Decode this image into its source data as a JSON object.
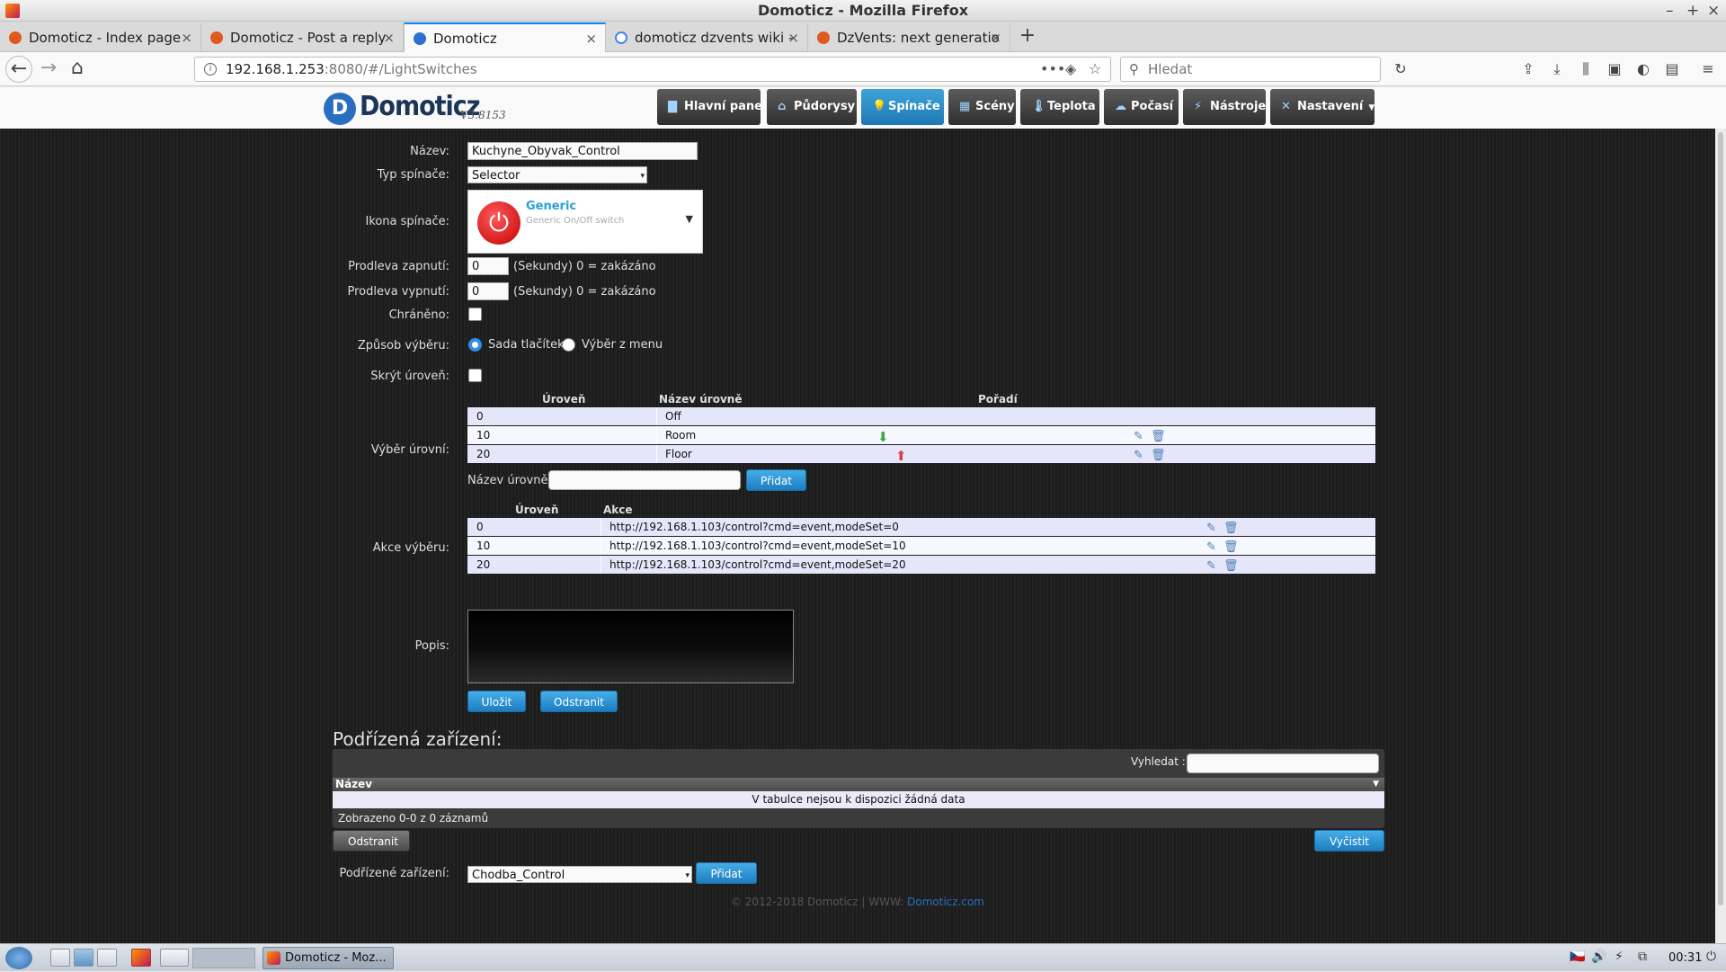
{
  "window": {
    "title": "Domoticz - Mozilla Firefox"
  },
  "tabs": [
    {
      "label": "Domoticz - Index page"
    },
    {
      "label": "Domoticz - Post a reply"
    },
    {
      "label": "Domoticz"
    },
    {
      "label": "domoticz dzvents wiki -"
    },
    {
      "label": "DzVents: next generatio"
    }
  ],
  "nav": {
    "url_host": "192.168.1.253",
    "url_rest": ":8080/#/LightSwitches",
    "search_placeholder": "Hledat"
  },
  "app": {
    "logo_name": "Domoticz",
    "version": "V3.8153",
    "menu": [
      {
        "label": "Hlavní panel"
      },
      {
        "label": "Půdorysy"
      },
      {
        "label": "Spínače"
      },
      {
        "label": "Scény"
      },
      {
        "label": "Teplota"
      },
      {
        "label": "Počasí"
      },
      {
        "label": "Nástroje"
      },
      {
        "label": "Nastavení"
      }
    ],
    "active_menu": "Spínače",
    "accent_color": "#2f8ee0"
  },
  "form": {
    "name_label": "Název:",
    "name_value": "Kuchyne_Obyvak_Control",
    "type_label": "Typ spínače:",
    "type_value": "Selector",
    "icon_label": "Ikona spínače:",
    "icon_title": "Generic",
    "icon_subtitle": "Generic On/Off switch",
    "on_delay_label": "Prodleva zapnutí:",
    "on_delay_value": "0",
    "off_delay_label": "Prodleva vypnutí:",
    "off_delay_value": "0",
    "delay_hint": "(Sekundy) 0 = zakázáno",
    "protected_label": "Chráněno:",
    "select_mode_label": "Způsob výběru:",
    "select_mode_buttons": "Sada tlačítek",
    "select_mode_menu": "Výběr z menu",
    "hide_level_label": "Skrýt úroveň:",
    "levels_label": "Výběr úrovní:",
    "levels_headers": {
      "level": "Úroveň",
      "name": "Název úrovně",
      "order": "Pořadí"
    },
    "levels": [
      {
        "level": "0",
        "name": "Off"
      },
      {
        "level": "10",
        "name": "Room"
      },
      {
        "level": "20",
        "name": "Floor"
      }
    ],
    "level_name_label": "Název úrovně:",
    "add_button": "Přidat",
    "actions_label": "Akce výběru:",
    "actions_headers": {
      "level": "Úroveň",
      "action": "Akce"
    },
    "actions": [
      {
        "level": "0",
        "action": "http://192.168.1.103/control?cmd=event,modeSet=0"
      },
      {
        "level": "10",
        "action": "http://192.168.1.103/control?cmd=event,modeSet=10"
      },
      {
        "level": "20",
        "action": "http://192.168.1.103/control?cmd=event,modeSet=20"
      }
    ],
    "description_label": "Popis:",
    "save_button": "Uložit",
    "delete_button": "Odstranit"
  },
  "subdevices": {
    "title": "Podřízená zařízení:",
    "search_label": "Vyhledat :",
    "col_name": "Název",
    "empty_text": "V tabulce nejsou k dispozici žádná data",
    "info_text": "Zobrazeno 0-0 z 0 záznamů",
    "delete_button": "Odstranit",
    "clear_button": "Vyčistit",
    "select_label": "Podřízené zařízení:",
    "select_value": "Chodba_Control",
    "add_button": "Přidat"
  },
  "footer": {
    "text": "© 2012-2018 Domoticz | WWW: ",
    "link": "Domoticz.com"
  },
  "taskbar": {
    "task_label": "Domoticz - Moz...",
    "clock": "00:31"
  }
}
